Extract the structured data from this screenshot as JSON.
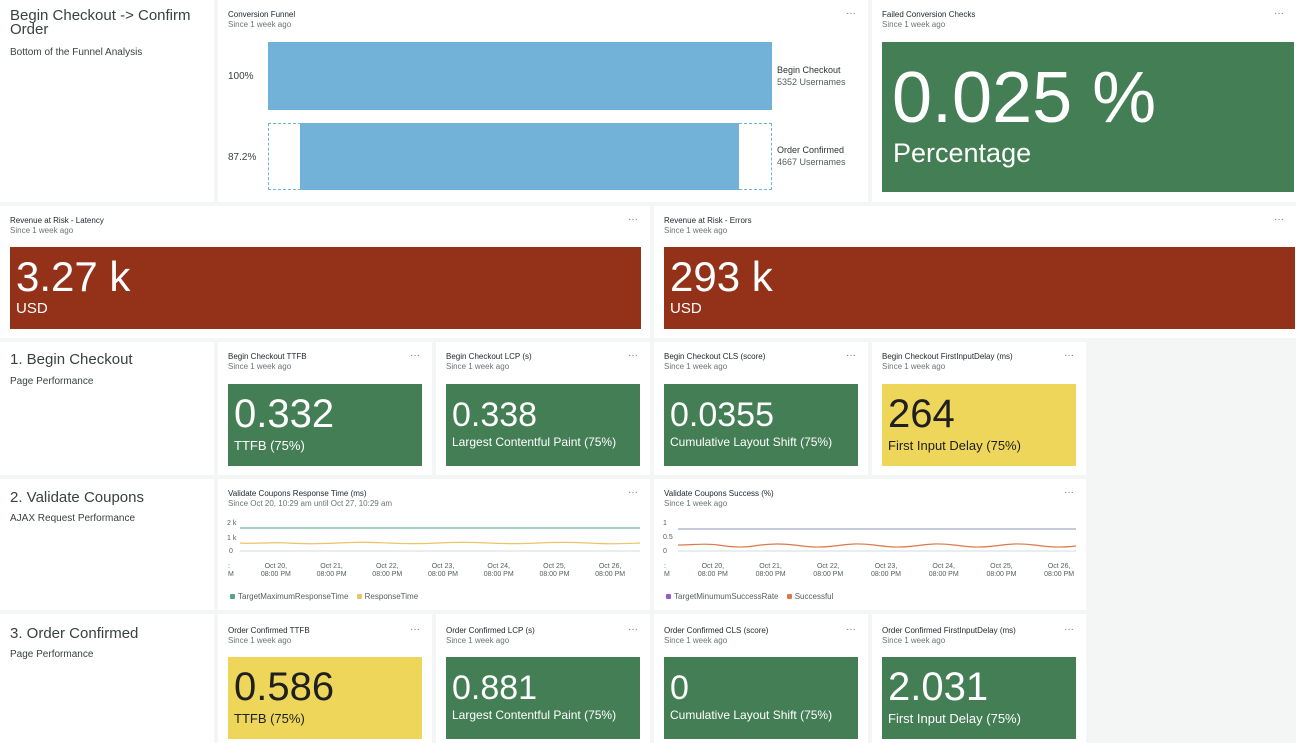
{
  "header": {
    "title": "Begin Checkout -> Confirm Order",
    "subtitle": "Bottom of the Funnel Analysis"
  },
  "funnel": {
    "title": "Conversion Funnel",
    "since": "Since 1 week ago",
    "steps": [
      {
        "pct": "100%",
        "name": "Begin Checkout",
        "count": "5352 Usernames",
        "fraction": 1.0
      },
      {
        "pct": "87.2%",
        "name": "Order Confirmed",
        "count": "4667 Usernames",
        "fraction": 0.872
      }
    ],
    "color": "#73b2d8"
  },
  "failed_checks": {
    "title": "Failed Conversion Checks",
    "since": "Since 1 week ago",
    "value": "0.025 %",
    "label": "Percentage"
  },
  "revenue_latency": {
    "title": "Revenue at Risk - Latency",
    "since": "Since 1 week ago",
    "value": "3.27 k",
    "label": "USD"
  },
  "revenue_errors": {
    "title": "Revenue at Risk - Errors",
    "since": "Since 1 week ago",
    "value": "293 k",
    "label": "USD"
  },
  "section1": {
    "title": "1. Begin Checkout",
    "subtitle": "Page Performance"
  },
  "section2": {
    "title": "2. Validate Coupons",
    "subtitle": "AJAX Request Performance"
  },
  "section3": {
    "title": "3. Order Confirmed",
    "subtitle": "Page Performance"
  },
  "begin_ttfb": {
    "title": "Begin Checkout TTFB",
    "since": "Since 1 week ago",
    "value": "0.332",
    "label": "TTFB (75%)",
    "status": "green"
  },
  "begin_lcp": {
    "title": "Begin Checkout LCP (s)",
    "since": "Since 1 week ago",
    "value": "0.338",
    "label": "Largest Contentful Paint (75%)",
    "status": "green"
  },
  "begin_cls": {
    "title": "Begin Checkout CLS (score)",
    "since": "Since 1 week ago",
    "value": "0.0355",
    "label": "Cumulative Layout Shift (75%)",
    "status": "green"
  },
  "begin_fid": {
    "title": "Begin Checkout FirstInputDelay (ms)",
    "since": "Since 1 week ago",
    "value": "264",
    "label": "First Input Delay (75%)",
    "status": "yellow"
  },
  "coupons_time": {
    "title": "Validate Coupons Response Time (ms)",
    "since": "Since Oct 20, 10:29 am until Oct 27, 10:29 am",
    "legend": [
      "TargetMaximumResponseTime",
      "ResponseTime"
    ],
    "legend_colors": [
      "#4fa68a",
      "#e9c56a"
    ],
    "y_ticks": [
      "2 k",
      "1 k",
      "0"
    ],
    "x_ticks": [
      {
        "d": "Oct 20,",
        "t": "08:00 PM"
      },
      {
        "d": "Oct 21,",
        "t": "08:00 PM"
      },
      {
        "d": "Oct 22,",
        "t": "08:00 PM"
      },
      {
        "d": "Oct 23,",
        "t": "08:00 PM"
      },
      {
        "d": "Oct 24,",
        "t": "08:00 PM"
      },
      {
        "d": "Oct 25,",
        "t": "08:00 PM"
      },
      {
        "d": "Oct 26,",
        "t": "08:00 PM"
      }
    ]
  },
  "coupons_success": {
    "title": "Validate Coupons Success (%)",
    "since": "Since 1 week ago",
    "legend": [
      "TargetMinumumSuccessRate",
      "Successful"
    ],
    "legend_colors": [
      "#9a5cc4",
      "#d97a4a"
    ],
    "y_ticks": [
      "1",
      "0.5",
      "0"
    ],
    "x_ticks": [
      {
        "d": "Oct 20,",
        "t": "08:00 PM"
      },
      {
        "d": "Oct 21,",
        "t": "08:00 PM"
      },
      {
        "d": "Oct 22,",
        "t": "08:00 PM"
      },
      {
        "d": "Oct 23,",
        "t": "08:00 PM"
      },
      {
        "d": "Oct 24,",
        "t": "08:00 PM"
      },
      {
        "d": "Oct 25,",
        "t": "08:00 PM"
      },
      {
        "d": "Oct 26,",
        "t": "08:00 PM"
      }
    ]
  },
  "order_ttfb": {
    "title": "Order Confirmed TTFB",
    "since": "Since 1 week ago",
    "value": "0.586",
    "label": "TTFB (75%)",
    "status": "yellow"
  },
  "order_lcp": {
    "title": "Order Confirmed LCP (s)",
    "since": "Since 1 week ago",
    "value": "0.881",
    "label": "Largest Contentful Paint (75%)",
    "status": "green"
  },
  "order_cls": {
    "title": "Order Confirmed CLS (score)",
    "since": "Since 1 week ago",
    "value": "0",
    "label": "Cumulative Layout Shift (75%)",
    "status": "green"
  },
  "order_fid": {
    "title": "Order Confirmed FirstInputDelay (ms)",
    "since": "Since 1 week ago",
    "value": "2.031",
    "label": "First Input Delay (75%)",
    "status": "green"
  },
  "menu_glyph": "···",
  "colors": {
    "green": "#447e55",
    "red": "#933219",
    "yellow": "#eed65a",
    "funnel": "#73b2d8"
  }
}
